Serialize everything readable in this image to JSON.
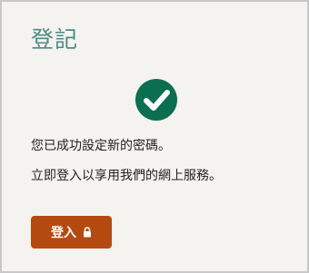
{
  "panel": {
    "title": "登記"
  },
  "status": {
    "icon": "check-circle-icon",
    "icon_color": "#0b6e4f",
    "message_1": "您已成功設定新的密碼。",
    "message_2": "立即登入以享用我們的網上服務。"
  },
  "actions": {
    "login_label": "登入",
    "login_icon": "lock-icon",
    "login_color": "#b54a10"
  }
}
